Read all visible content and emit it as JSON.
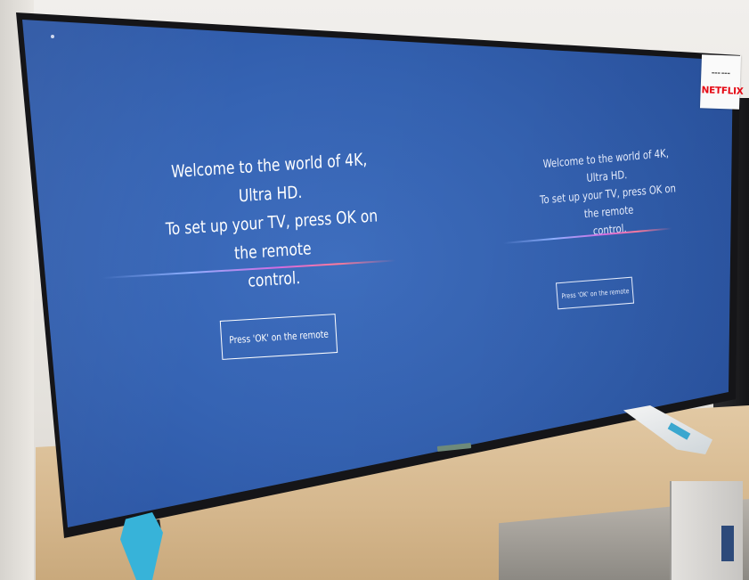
{
  "scene": {
    "left_welcome_lines": [
      "Welcome to the world of 4K, Ultra HD.",
      "To set up your TV, press OK on the remote",
      "control."
    ],
    "left_button_label": "Press 'OK' on the remote",
    "right_welcome_lines": [
      "Welcome to the world of 4K, Ultra HD.",
      "To set up your TV, press OK on the remote",
      "control."
    ],
    "right_button_label": "Press 'OK' on the remote",
    "sticker_logo": "NETFLIX",
    "colors": {
      "screen_blue": "#3563b3",
      "netflix_red": "#e50914",
      "tape_blue": "#37b3d9",
      "table_wood": "#d5b78d"
    }
  }
}
